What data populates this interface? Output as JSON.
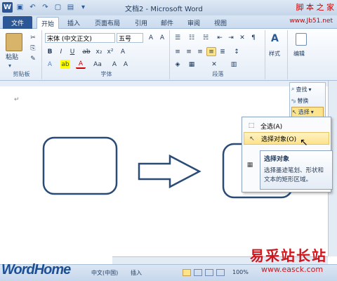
{
  "window": {
    "title": "文档2 - Microsoft Word",
    "watermark_top": "脚 本 之 家",
    "watermark_url": "www.Jb51.net"
  },
  "tabs": [
    {
      "label": "文件"
    },
    {
      "label": "开始"
    },
    {
      "label": "插入"
    },
    {
      "label": "页面布局"
    },
    {
      "label": "引用"
    },
    {
      "label": "邮件"
    },
    {
      "label": "审阅"
    },
    {
      "label": "视图"
    }
  ],
  "ribbon": {
    "clipboard": {
      "paste_label": "粘贴",
      "group_label": "剪贴板"
    },
    "font": {
      "font_name": "宋体 (中文正文)",
      "font_size": "五号",
      "group_label": "字体"
    },
    "paragraph": {
      "group_label": "段落"
    },
    "styles": {
      "label": "样式"
    },
    "editing": {
      "label": "编辑",
      "find": "查找",
      "replace": "替换",
      "select": "选择"
    }
  },
  "select_menu": {
    "items": [
      {
        "label": "全选(A)",
        "icon": "select-all-icon"
      },
      {
        "label": "选择对象(O)",
        "icon": "pointer-icon"
      }
    ]
  },
  "tooltip": {
    "title": "选择对象",
    "body": "选择墨迹笔划、形状和文本的矩形区域。"
  },
  "status": {
    "language": "中文(中国)",
    "mode": "插入",
    "zoom": "100%"
  },
  "brand": {
    "wordhome": "WordHome",
    "watermark_cn": "易采站长站",
    "watermark_site": "www.easck.com"
  },
  "colors": {
    "accent": "#2b5797",
    "shape_stroke": "#2a4b75",
    "highlight": "#fde389"
  }
}
